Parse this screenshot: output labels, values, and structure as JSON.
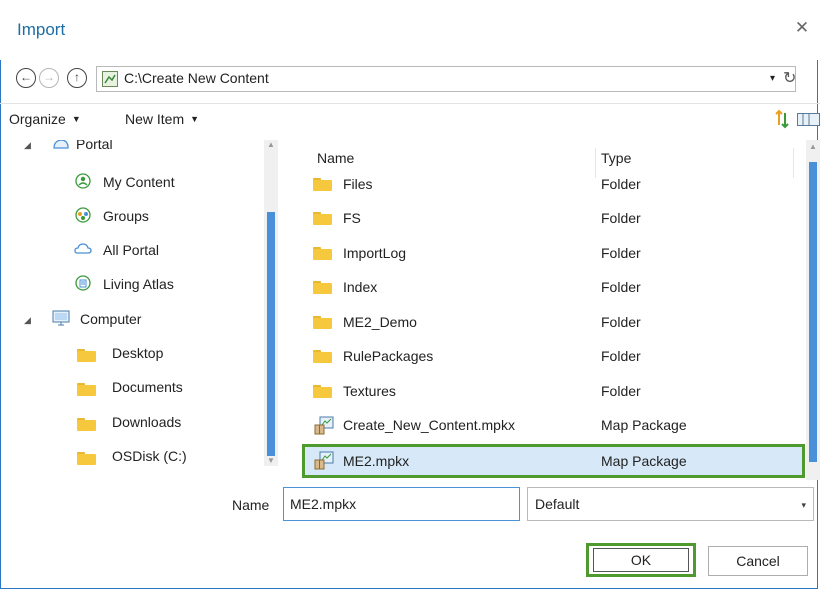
{
  "dialog": {
    "title": "Import",
    "close_glyph": "✕"
  },
  "nav": {
    "back_glyph": "←",
    "forward_glyph": "→",
    "up_glyph": "↑",
    "address": "C:\\Create New Content",
    "dropdown_glyph": "▾",
    "refresh_glyph": "↻"
  },
  "toolbar": {
    "organize": "Organize",
    "new_item": "New Item",
    "caret": "▼"
  },
  "tree": {
    "expand_glyph": "◢",
    "items": [
      {
        "label": "Portal",
        "icon": "portal-icon"
      },
      {
        "label": "My Content",
        "icon": "my-content-icon"
      },
      {
        "label": "Groups",
        "icon": "groups-icon"
      },
      {
        "label": "All Portal",
        "icon": "cloud-icon"
      },
      {
        "label": "Living Atlas",
        "icon": "living-atlas-icon"
      },
      {
        "label": "Computer",
        "icon": "computer-icon"
      },
      {
        "label": "Desktop",
        "icon": "folder-icon"
      },
      {
        "label": "Documents",
        "icon": "folder-icon"
      },
      {
        "label": "Downloads",
        "icon": "folder-icon"
      },
      {
        "label": "OSDisk (C:)",
        "icon": "folder-icon"
      }
    ]
  },
  "list": {
    "columns": {
      "name": "Name",
      "type": "Type"
    },
    "rows": [
      {
        "name": "Files",
        "type": "Folder",
        "icon": "folder-icon"
      },
      {
        "name": "FS",
        "type": "Folder",
        "icon": "folder-icon"
      },
      {
        "name": "ImportLog",
        "type": "Folder",
        "icon": "folder-icon"
      },
      {
        "name": "Index",
        "type": "Folder",
        "icon": "folder-icon"
      },
      {
        "name": "ME2_Demo",
        "type": "Folder",
        "icon": "folder-icon"
      },
      {
        "name": "RulePackages",
        "type": "Folder",
        "icon": "folder-icon"
      },
      {
        "name": "Textures",
        "type": "Folder",
        "icon": "folder-icon"
      },
      {
        "name": "Create_New_Content.mpkx",
        "type": "Map Package",
        "icon": "map-package-icon"
      },
      {
        "name": "ME2.mpkx",
        "type": "Map Package",
        "icon": "map-package-icon",
        "selected": true
      }
    ]
  },
  "footer": {
    "name_label": "Name",
    "name_value": "ME2.mpkx",
    "filter_value": "Default",
    "dropdown_glyph": "▾",
    "ok": "OK",
    "cancel": "Cancel"
  },
  "colors": {
    "accent": "#1c6ea4",
    "selection": "#d7e9f8",
    "highlight": "#4e9a2f",
    "scroll_thumb": "#4a90d8"
  }
}
